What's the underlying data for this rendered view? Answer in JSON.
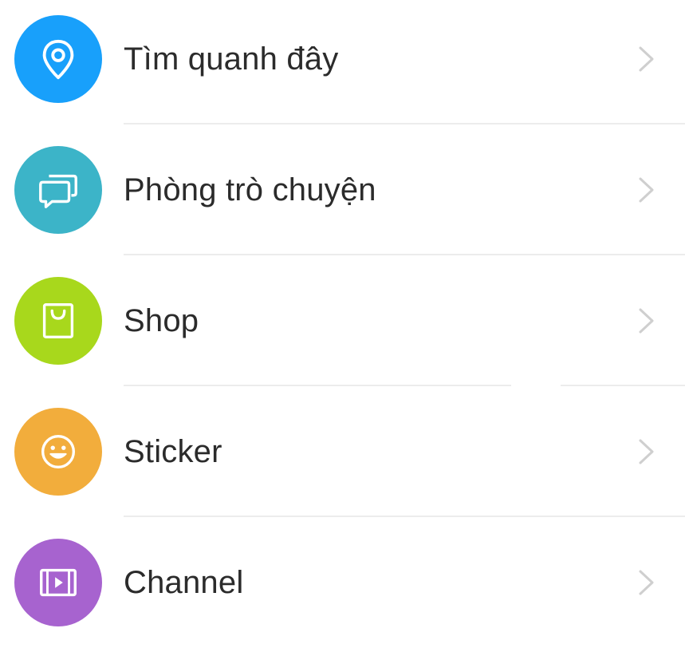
{
  "menu": {
    "items": [
      {
        "label": "Tìm quanh đây",
        "icon": "location-pin-icon",
        "color": "#18a0fb"
      },
      {
        "label": "Phòng trò chuyện",
        "icon": "chat-rooms-icon",
        "color": "#3cb4c8"
      },
      {
        "label": "Shop",
        "icon": "shopping-bag-icon",
        "color": "#a8d81c"
      },
      {
        "label": "Sticker",
        "icon": "smiley-face-icon",
        "color": "#f2ad3c"
      },
      {
        "label": "Channel",
        "icon": "video-channel-icon",
        "color": "#a763cf"
      }
    ]
  },
  "colors": {
    "text": "#2b2b2b",
    "chevron": "#cfcfcf",
    "divider": "#ececec",
    "background": "#ffffff"
  }
}
